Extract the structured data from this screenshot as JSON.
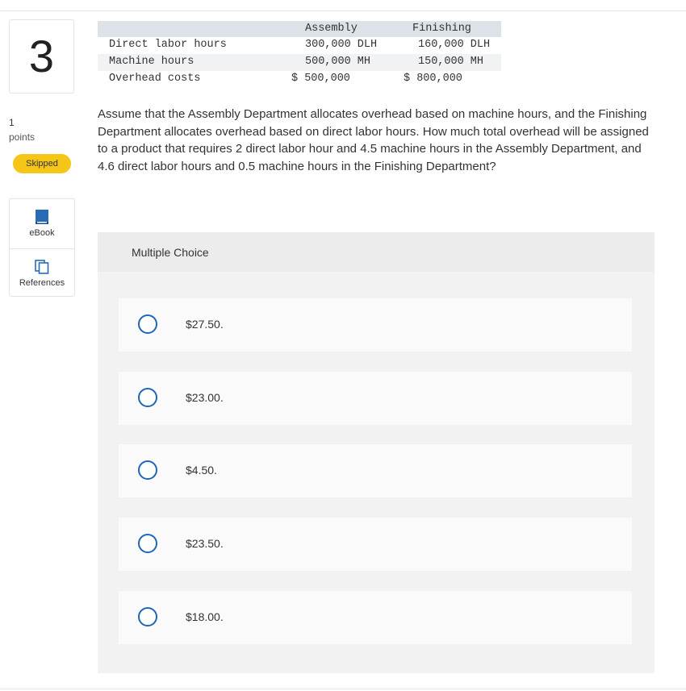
{
  "sidebar": {
    "question_number": "3",
    "points_value": "1",
    "points_label": "points",
    "status_badge": "Skipped",
    "status_color": "#f5c518",
    "tools": [
      {
        "label": "eBook",
        "icon": "book-icon"
      },
      {
        "label": "References",
        "icon": "references-icon"
      }
    ]
  },
  "data_table": {
    "headers": [
      "",
      "Assembly",
      "Finishing"
    ],
    "rows": [
      {
        "label": "Direct labor hours",
        "assembly": "300,000 DLH",
        "finishing": "160,000 DLH"
      },
      {
        "label": "Machine hours",
        "assembly": "500,000 MH",
        "finishing": "150,000 MH"
      },
      {
        "label": "Overhead costs",
        "assembly": "$ 500,000",
        "finishing": "$ 800,000"
      }
    ]
  },
  "question": {
    "text": "Assume that the Assembly Department allocates overhead based on machine hours, and the Finishing Department allocates overhead based on direct labor hours. How much total overhead will be assigned to a product that requires 2 direct labor hour and 4.5 machine hours in the Assembly Department, and 4.6 direct labor hours and 0.5 machine hours in the Finishing Department?"
  },
  "multiple_choice": {
    "title": "Multiple Choice",
    "accent_color": "#1d66b7",
    "options": [
      {
        "label": "$27.50."
      },
      {
        "label": "$23.00."
      },
      {
        "label": "$4.50."
      },
      {
        "label": "$23.50."
      },
      {
        "label": "$18.00."
      }
    ]
  }
}
